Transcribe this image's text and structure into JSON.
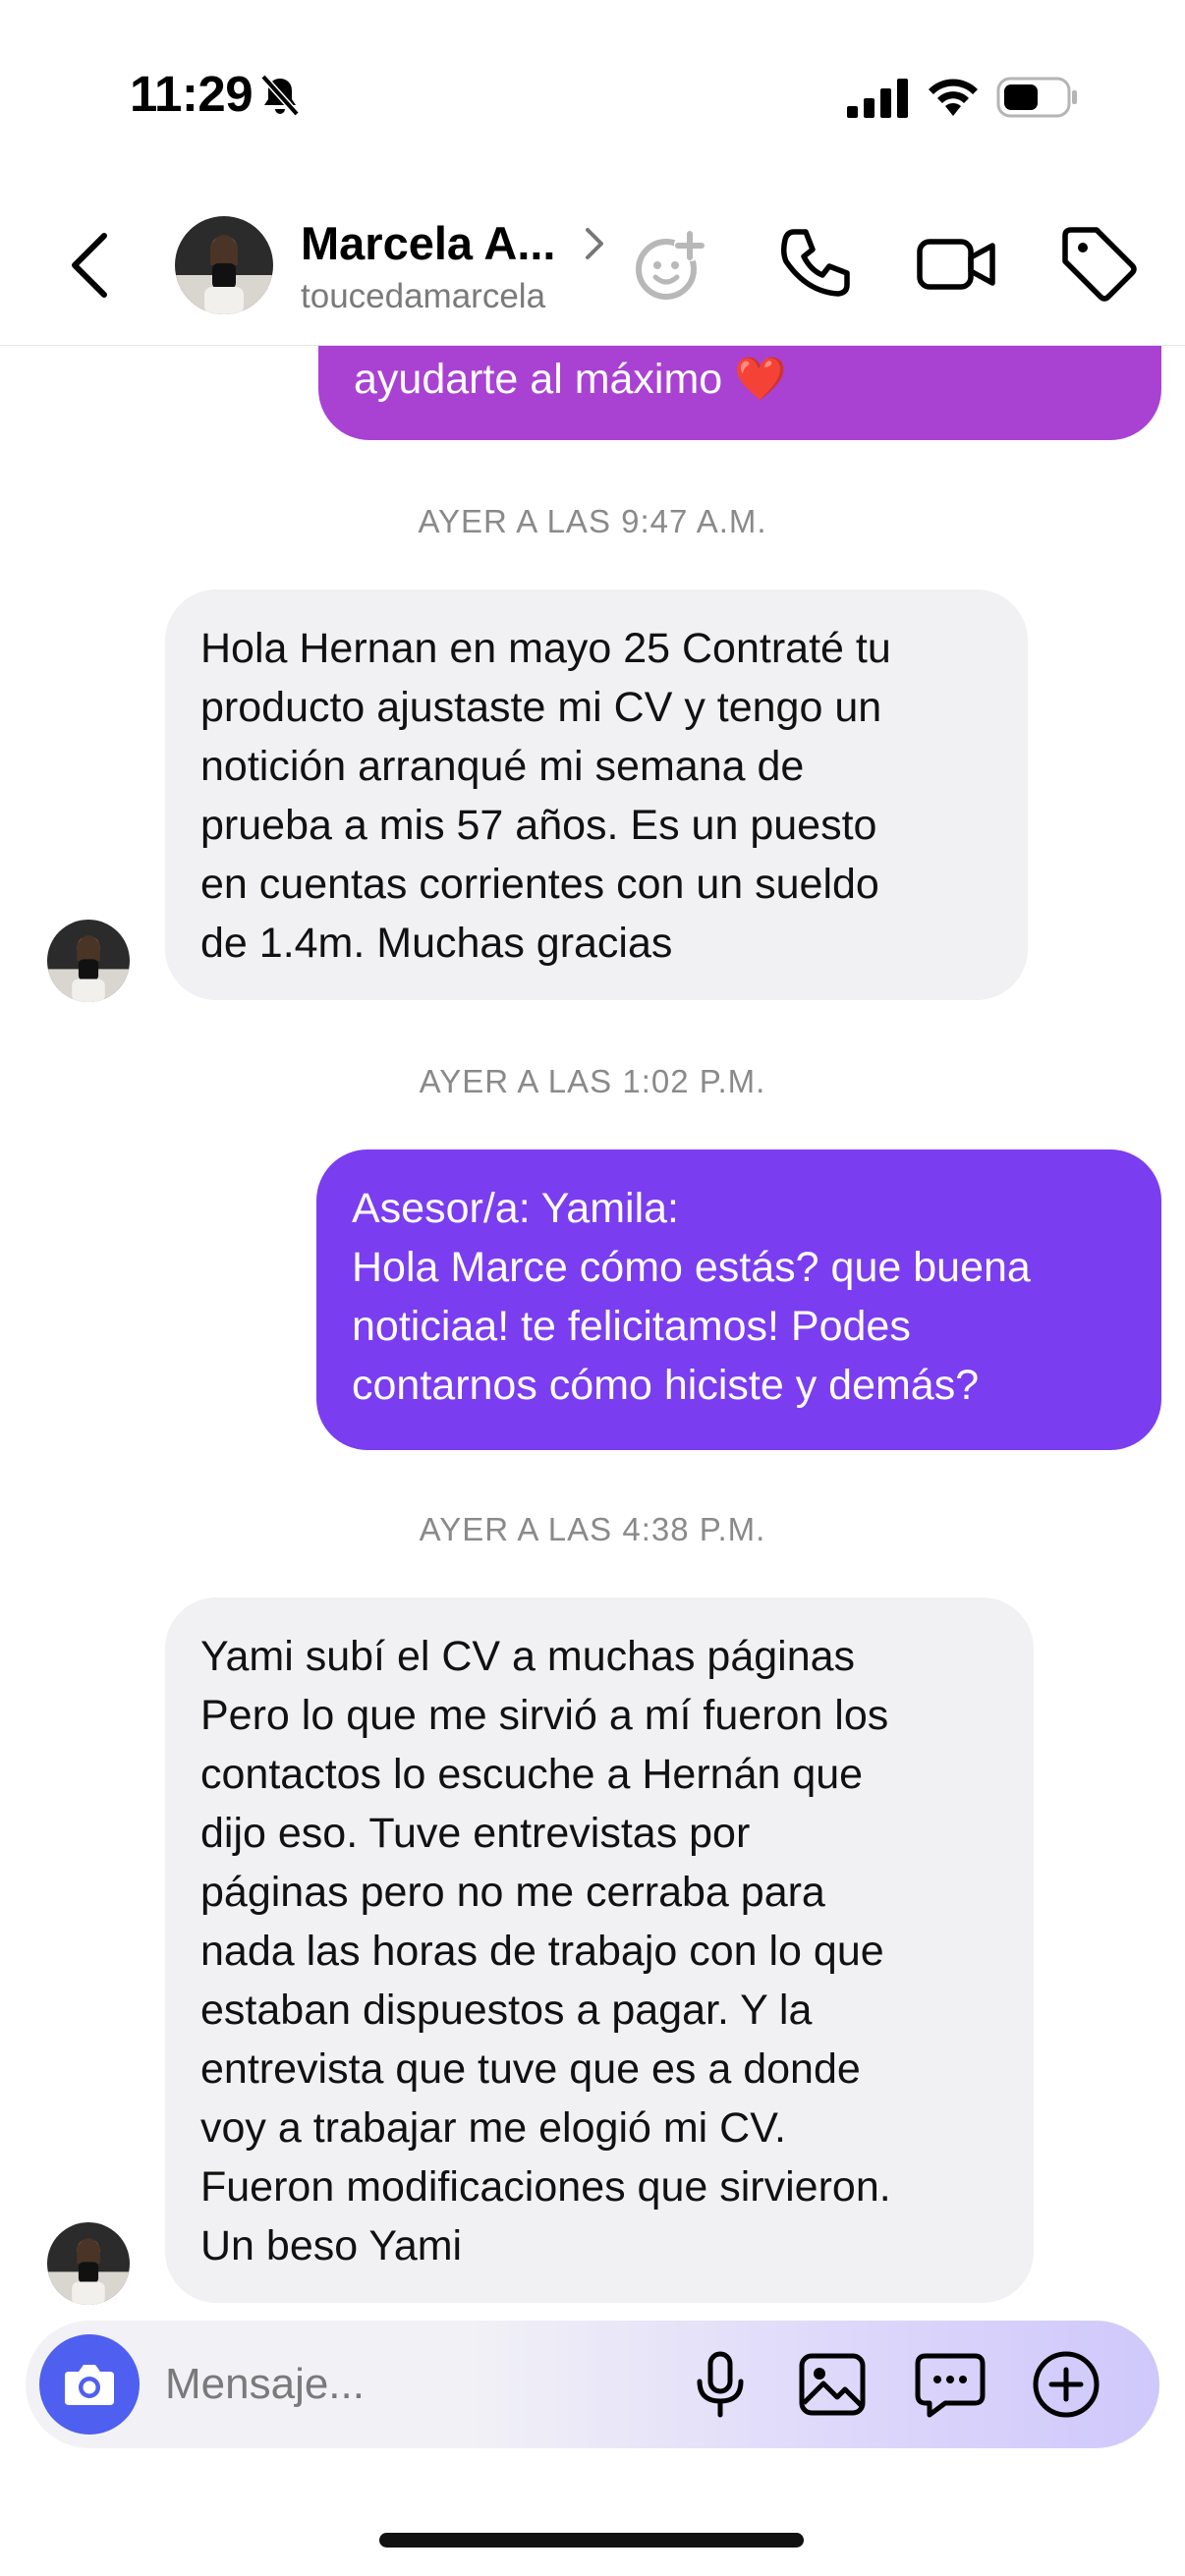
{
  "status_bar": {
    "time": "11:29"
  },
  "header": {
    "contact_name": "Marcela A...",
    "username": "toucedamarcela"
  },
  "colors": {
    "outgoing_top": "#a942d3",
    "outgoing_bubble": "#7b3df0",
    "incoming_bubble": "#f1f1f4",
    "camera_button": "#4f5ff0"
  },
  "messages": [
    {
      "type": "outgoing",
      "text": "ayudarte al máximo ❤️"
    },
    {
      "type": "timestamp",
      "text": "AYER A LAS 9:47 A.M."
    },
    {
      "type": "incoming",
      "text": "Hola Hernan en mayo 25 Contraté tu\nproducto ajustaste mi CV y tengo un\nnotición arranqué mi semana de\nprueba a mis 57 años. Es un puesto\nen cuentas corrientes con un sueldo\nde 1.4m. Muchas gracias"
    },
    {
      "type": "timestamp",
      "text": "AYER A LAS 1:02 P.M."
    },
    {
      "type": "outgoing",
      "text": "Asesor/a: Yamila:\nHola Marce cómo estás? que buena\nnoticiaa! te felicitamos! Podes\ncontarnos cómo hiciste y demás?"
    },
    {
      "type": "timestamp",
      "text": "AYER A LAS 4:38 P.M."
    },
    {
      "type": "incoming",
      "text": "Yami subí el CV a muchas páginas\nPero lo que me sirvió a mí fueron los\ncontactos lo escuche a Hernán que\ndijo eso. Tuve entrevistas por\npáginas pero no me cerraba para\nnada las horas de trabajo con lo que\nestaban dispuestos a pagar.  Y la\nentrevista que tuve que es a donde\nvoy a trabajar me elogió mi CV.\nFueron modificaciones que sirvieron.\nUn beso Yami"
    }
  ],
  "composer": {
    "placeholder": "Mensaje..."
  }
}
